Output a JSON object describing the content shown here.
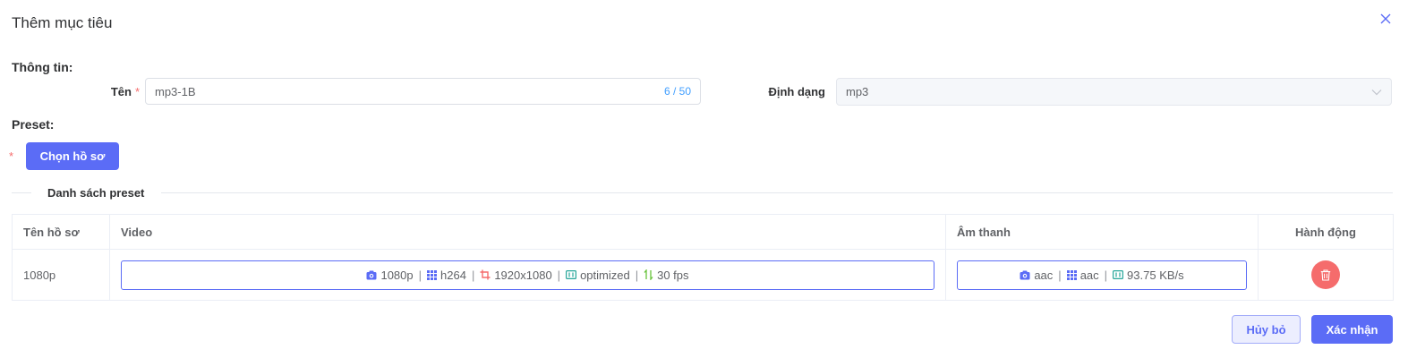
{
  "dialog": {
    "title": "Thêm mục tiêu",
    "close_icon": "close-icon"
  },
  "info": {
    "section_label": "Thông tin:",
    "name_label": "Tên",
    "required_mark": "*",
    "name_value": "mp3-1B",
    "name_counter": "6 / 50",
    "format_label": "Định dạng",
    "format_value": "mp3"
  },
  "preset": {
    "section_label": "Preset:",
    "required_mark": "*",
    "choose_button": "Chọn hồ sơ",
    "list_title": "Danh sách preset"
  },
  "table": {
    "headers": [
      "Tên hồ sơ",
      "Video",
      "Âm thanh",
      "Hành động"
    ],
    "rows": [
      {
        "name": "1080p",
        "video": {
          "resolution_name": "1080p",
          "codec": "h264",
          "size": "1920x1080",
          "mode": "optimized",
          "fps": "30 fps"
        },
        "audio": {
          "name": "aac",
          "codec": "aac",
          "bitrate": "93.75 KB/s"
        }
      }
    ]
  },
  "footer": {
    "cancel_label": "Hủy bỏ",
    "confirm_label": "Xác nhận"
  },
  "colors": {
    "primary": "#5b6cf6",
    "danger": "#f56c6c",
    "counter": "#409eff",
    "video_crop_icon": "#f56c6c",
    "fps_icon": "#67c23a",
    "mode_icon": "#26a69a"
  }
}
